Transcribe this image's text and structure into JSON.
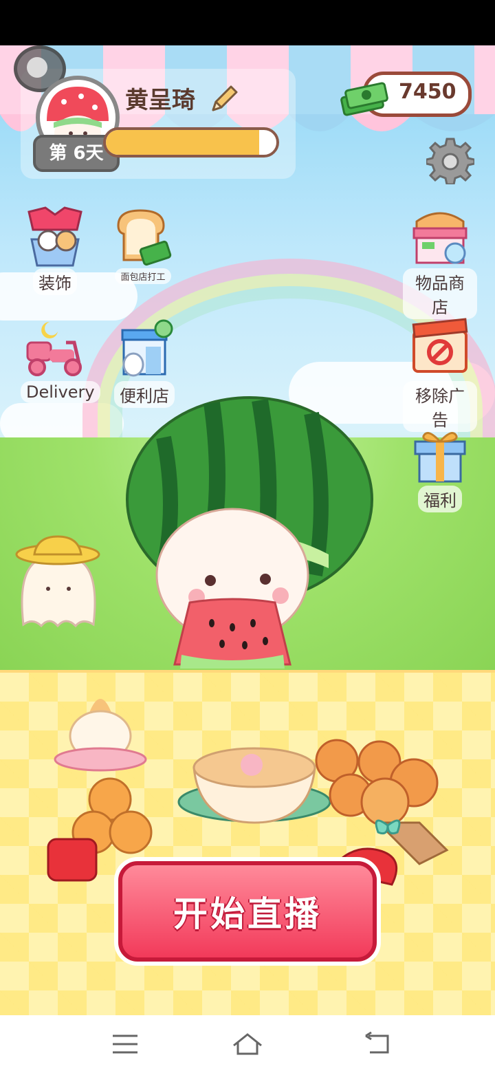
{
  "player": {
    "name": "黄呈琦",
    "day_label": "第 6天",
    "xp_fraction": 0.9
  },
  "currency": {
    "money": "7450",
    "icon": "cash-stack-icon"
  },
  "menu_left": [
    {
      "label": "装饰",
      "icon": "clothes-basket-icon"
    },
    {
      "label": "面包店打工",
      "icon": "bread-icon"
    },
    {
      "label": "Delivery",
      "icon": "scooter-icon"
    },
    {
      "label": "便利店",
      "icon": "convenience-store-icon"
    }
  ],
  "menu_right": [
    {
      "label": "物品商店",
      "icon": "shop-stall-icon"
    },
    {
      "label": "移除广告",
      "icon": "no-ads-icon"
    },
    {
      "label": "福利",
      "icon": "gift-box-icon"
    }
  ],
  "main_action": {
    "label": "开始直播"
  },
  "colors": {
    "primary_button": "#f23a5a",
    "money_border": "#9a4a3a",
    "xp_fill": "#f8c24c"
  }
}
